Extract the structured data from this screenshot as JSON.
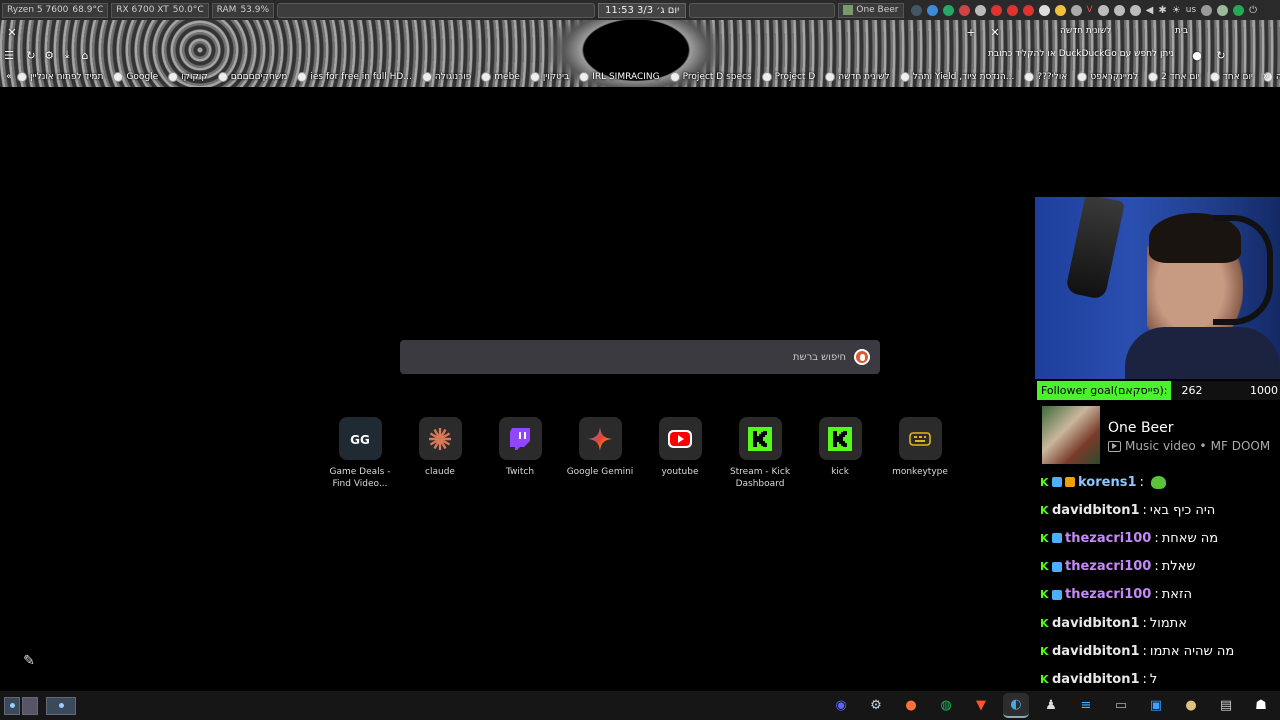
{
  "system_bar": {
    "cpu_label": "Ryzen 5 7600",
    "cpu_temp": "68.9°C",
    "gpu_label": "RX 6700 XT",
    "gpu_temp": "50.0°C",
    "ram_label": "RAM",
    "ram_percent": "53.9%",
    "clock": "11:53 יום ג׳ 3/3",
    "media_title": "One Beer",
    "keyboard_layout": "us",
    "tray_colors": [
      "#c33",
      "#d44",
      "#c33",
      "#d44",
      "#e55",
      "#f0c040",
      "#ccc"
    ]
  },
  "browser": {
    "tab_title": "לשונית חדשה",
    "tab_title_2": "בית",
    "address_placeholder": "ניתן לחפש עם DuckDuckGo או להקליד כתובת",
    "bookmarks": [
      "תמיד לפתוח אונליין",
      "Google",
      "קוקוקו",
      "משחקיםםםםם",
      "...ies for free in full HD",
      "פורנוגולה",
      "mebe",
      "ביטקוין",
      "IRL SIMRACING",
      "Project D specs",
      "Project D",
      "לשונית חדשה",
      "...הנדסת ציוד, Yield ותהל",
      "אולי???",
      "למיינקראפט",
      "יום אחד 2",
      "יום אחד",
      "תעודה"
    ]
  },
  "search": {
    "placeholder": "חיפוש ברשת"
  },
  "shortcuts": [
    {
      "label": "Game Deals - Find Video...",
      "icon": "gg-deals-icon",
      "color": "#1b2838"
    },
    {
      "label": "claude",
      "icon": "claude-icon",
      "color": "#d97757"
    },
    {
      "label": "Twitch",
      "icon": "twitch-icon",
      "color": "#9146ff"
    },
    {
      "label": "Google Gemini",
      "icon": "gemini-icon",
      "color": "#4285f4"
    },
    {
      "label": "youtube",
      "icon": "youtube-icon",
      "color": "#ff0000"
    },
    {
      "label": "Stream - Kick Dashboard",
      "icon": "kick-icon",
      "color": "#53fc18"
    },
    {
      "label": "kick",
      "icon": "kick-icon",
      "color": "#53fc18"
    },
    {
      "label": "monkeytype",
      "icon": "monkeytype-icon",
      "color": "#e2b714"
    }
  ],
  "stream": {
    "follower_goal_label": "Follower goal(פייסקאם):",
    "follower_count": "262",
    "follower_target": "1000",
    "now_playing_title": "One Beer",
    "now_playing_type": "Music video •",
    "now_playing_artist": "MF DOOM",
    "chat": [
      {
        "user": "korens1",
        "text": "",
        "color": "#8ec7ff",
        "badges": [
          "#4ab0ff",
          "#f0a000"
        ],
        "emote": true
      },
      {
        "user": "davidbiton1",
        "text": "היה כיף באי",
        "color": "#e8e8e8",
        "badges": [],
        "emote": false
      },
      {
        "user": "thezacri100",
        "text": "מה שאחת",
        "color": "#c58af9",
        "badges": [
          "#4ab0ff"
        ],
        "emote": false
      },
      {
        "user": "thezacri100",
        "text": "שאלת",
        "color": "#c58af9",
        "badges": [
          "#4ab0ff"
        ],
        "emote": false
      },
      {
        "user": "thezacri100",
        "text": "הזאת",
        "color": "#c58af9",
        "badges": [
          "#4ab0ff"
        ],
        "emote": false
      },
      {
        "user": "davidbiton1",
        "text": "אתמול",
        "color": "#e8e8e8",
        "badges": [],
        "emote": false
      },
      {
        "user": "davidbiton1",
        "text": "מה שהיה אתמו",
        "color": "#e8e8e8",
        "badges": [],
        "emote": false
      },
      {
        "user": "davidbiton1",
        "text": "ל",
        "color": "#e8e8e8",
        "badges": [],
        "emote": false
      }
    ],
    "chat_separator": ":"
  },
  "taskbar": {
    "apps": [
      "discord-icon",
      "steam-icon",
      "firefox-icon",
      "spotify-icon",
      "brave-icon",
      "browser-icon",
      "kick-app-icon",
      "layers-icon",
      "files-icon",
      "store-icon",
      "media-icon",
      "terminal-icon",
      "ghost-icon"
    ],
    "active_app_index": 5
  }
}
